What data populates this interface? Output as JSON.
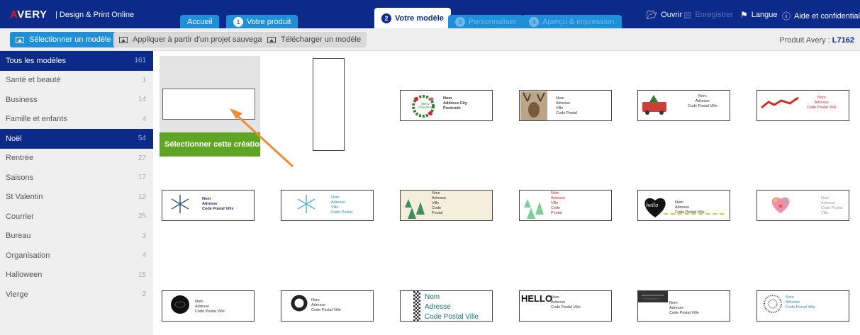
{
  "brand": {
    "logo": "AVERY",
    "tagline": "| Design & Print Online"
  },
  "tabs": [
    {
      "num": "",
      "label": "Accueil",
      "state": "normal"
    },
    {
      "num": "1",
      "label": "Votre produit",
      "state": "normal"
    },
    {
      "num": "2",
      "label": "Votre modèle",
      "state": "active"
    },
    {
      "num": "3",
      "label": "Personnaliser",
      "state": "disabled"
    },
    {
      "num": "4",
      "label": "Aperçu & impression",
      "state": "disabled"
    }
  ],
  "top_actions": [
    {
      "label": "Ouvrir",
      "icon": "folder-icon",
      "enabled": true
    },
    {
      "label": "Enregistrer",
      "icon": "save-icon",
      "enabled": false
    },
    {
      "label": "Langue",
      "icon": "flag-icon",
      "enabled": true
    },
    {
      "label": "Aide et confidentialité",
      "icon": "help-icon",
      "enabled": true
    }
  ],
  "toolbar": {
    "select_template": "Sélectionner un modèle",
    "apply_saved": "Appliquer à partir d'un projet sauvegardé",
    "download_template": "Télécharger un modèle",
    "product_label": "Produit Avery :",
    "product_code": "L7162"
  },
  "categories": [
    {
      "label": "Tous les modèles",
      "count": "161",
      "selected": true
    },
    {
      "label": "Santé et beauté",
      "count": "1",
      "selected": false
    },
    {
      "label": "Business",
      "count": "14",
      "selected": false
    },
    {
      "label": "Famille et enfants",
      "count": "4",
      "selected": false
    },
    {
      "label": "Noël",
      "count": "54",
      "selected": true
    },
    {
      "label": "Rentrée",
      "count": "27",
      "selected": false
    },
    {
      "label": "Saisons",
      "count": "17",
      "selected": false
    },
    {
      "label": "St Valentin",
      "count": "12",
      "selected": false
    },
    {
      "label": "Courrier",
      "count": "25",
      "selected": false
    },
    {
      "label": "Bureau",
      "count": "3",
      "selected": false
    },
    {
      "label": "Organisation",
      "count": "4",
      "selected": false
    },
    {
      "label": "Halloween",
      "count": "15",
      "selected": false
    },
    {
      "label": "Vierge",
      "count": "2",
      "selected": false
    }
  ],
  "gallery": {
    "select_creation": "Sélectionner cette création",
    "templates": [
      {
        "name": "christmas-wreath",
        "lines": [
          "Nom",
          "Address City",
          "Postcode"
        ],
        "art_text": "Merry Christmas"
      },
      {
        "name": "reindeer-photo",
        "lines": [
          "Nom",
          "Adresse",
          "Ville",
          "Code Postal"
        ]
      },
      {
        "name": "christmas-bus",
        "lines": [
          "Nom",
          "Adresse",
          "Code Postal Ville"
        ]
      },
      {
        "name": "red-reindeer",
        "lines": [
          "Nom",
          "Adresse",
          "Code Postal Ville"
        ]
      },
      {
        "name": "snowflake-dark",
        "lines": [
          "Nom",
          "Adresse",
          "Code Postal Ville"
        ]
      },
      {
        "name": "snowflake-teal",
        "lines": [
          "Nom",
          "Adresse",
          "Ville",
          "Code Postal"
        ]
      },
      {
        "name": "trees-cream",
        "lines": [
          "Nom",
          "Adresse",
          "Ville",
          "Code",
          "Postal"
        ]
      },
      {
        "name": "trees-red",
        "lines": [
          "Nom",
          "Adresse",
          "Ville",
          "Code",
          "Postal"
        ]
      },
      {
        "name": "hello-heart",
        "lines": [
          "Nom",
          "Adresse",
          "Code Postal Ville"
        ],
        "art_text": "hello"
      },
      {
        "name": "floral-heart",
        "lines": [
          "Nom",
          "Adresse",
          "Code Postal Ville"
        ]
      },
      {
        "name": "black-circle",
        "lines": [
          "Nom",
          "Adresse",
          "Code Postal Ville"
        ]
      },
      {
        "name": "ring-circle",
        "lines": [
          "Nom",
          "Adresse",
          "Code Postal Ville"
        ]
      },
      {
        "name": "checker-strip",
        "lines": [
          "Nom",
          "Adresse",
          "Code Postal Ville"
        ]
      },
      {
        "name": "hello-logo",
        "lines": [
          "Nom",
          "Adresse",
          "Code Postal Ville"
        ],
        "art_text": "HELLO"
      },
      {
        "name": "chalk-banner",
        "lines": [
          "Nom",
          "Adresse",
          "Code Postal Ville"
        ]
      },
      {
        "name": "mandala",
        "lines": [
          "Nom",
          "Adresse",
          "Code Postal Ville"
        ]
      }
    ]
  },
  "colors": {
    "nav_blue": "#0b2a8a",
    "tab_blue": "#1e8fd8",
    "green": "#5ea524",
    "arrow": "#f08a3c"
  }
}
